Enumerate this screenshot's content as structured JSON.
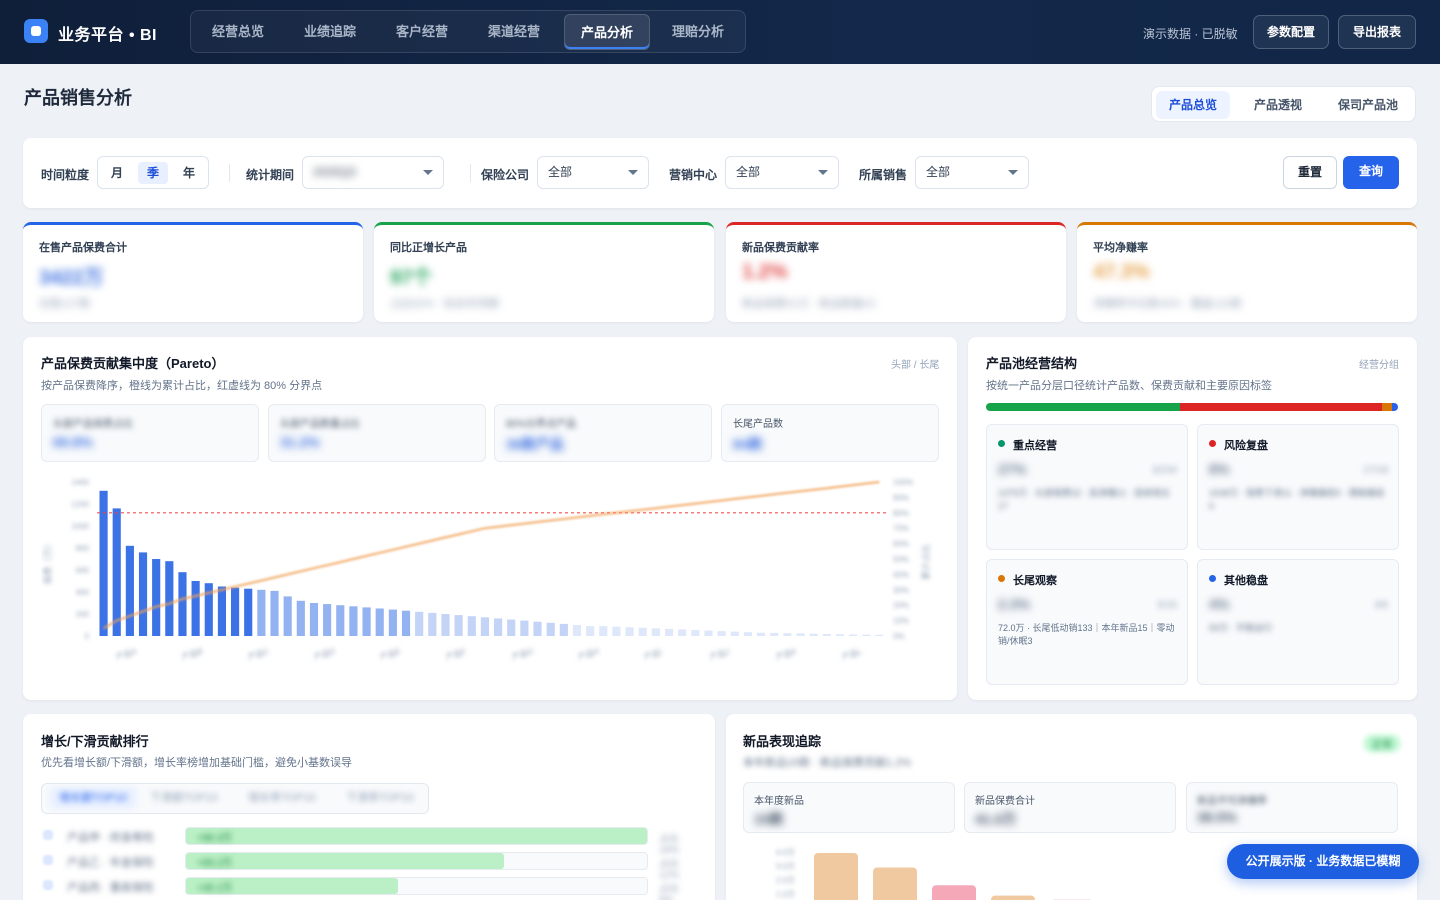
{
  "brand": "业务平台 • BI",
  "nav": {
    "tabs": [
      "经营总览",
      "业绩追踪",
      "客户经营",
      "渠道经营",
      "产品分析",
      "理赔分析"
    ],
    "active": "产品分析"
  },
  "header": {
    "demo_text": "演示数据 · 已脱敏",
    "config_button": "参数配置",
    "export_button": "导出报表"
  },
  "page": {
    "title": "产品销售分析",
    "view_tabs": [
      "产品总览",
      "产品透视",
      "保司产品池"
    ],
    "active_view": "产品总览"
  },
  "filters": {
    "granularity_label": "时间粒度",
    "granularity_options": [
      "月",
      "季",
      "年"
    ],
    "granularity_selected": "季",
    "period_label": "统计期间",
    "period_value": "2025Q3",
    "company_label": "保险公司",
    "company_value": "全部",
    "center_label": "营销中心",
    "center_value": "全部",
    "sales_label": "所属销售",
    "sales_value": "全部",
    "reset_button": "重置",
    "query_button": "查询"
  },
  "kpis": [
    {
      "label": "在售产品保费合计",
      "value": "3422万",
      "sub": "在售127款",
      "color": "#2563eb",
      "value_color": "#3b6fe0"
    },
    {
      "label": "同比正增长产品",
      "value": "97个",
      "sub": "占比62% · 较去年同期",
      "color": "#16a34a",
      "value_color": "#22a35a"
    },
    {
      "label": "新品保费贡献率",
      "value": "1.2%",
      "sub": "新品保费41万 · 新品数量15",
      "color": "#dc2626",
      "value_color": "#e04444"
    },
    {
      "label": "平均净赚率",
      "value": "47.3%",
      "sub": "净赚率中位数43% · 覆盖120款",
      "color": "#d97706",
      "value_color": "#e6a24a"
    }
  ],
  "pareto": {
    "title": "产品保费贡献集中度（Pareto）",
    "subtitle": "按产品保费降序，橙线为累计占比，红虚线为 80% 分界点",
    "tag": "头部 / 长尾",
    "summary": [
      {
        "label": "头部产品保费占比",
        "value": "69.8%"
      },
      {
        "label": "头部产品数量占比",
        "value": "31.2%"
      },
      {
        "label": "80%分界点产品",
        "value": "36款产品"
      },
      {
        "label": "长尾产品数",
        "value": "84款"
      }
    ]
  },
  "chart_data": {
    "type": "bar",
    "title": "产品保费贡献集中度（Pareto）",
    "xlabel": "",
    "ylabel": "保费（万）",
    "y2label": "累计占比",
    "ylim": [
      0,
      1400
    ],
    "y2lim": [
      0,
      100
    ],
    "threshold_percent": 80,
    "series": [
      {
        "type": "bar",
        "values": [
          1320,
          1160,
          820,
          760,
          700,
          680,
          580,
          500,
          480,
          450,
          440,
          430,
          420,
          410,
          360,
          320,
          300,
          290,
          280,
          270,
          260,
          250,
          240,
          230,
          220,
          210,
          200,
          190,
          180,
          170,
          160,
          150,
          140,
          130,
          120,
          110,
          100,
          90,
          90,
          85,
          80,
          75,
          70,
          65,
          60,
          55,
          50,
          45,
          40,
          35,
          30,
          28,
          26,
          24,
          20,
          18,
          16,
          14,
          12,
          10
        ]
      },
      {
        "type": "line",
        "values": [
          5,
          10,
          13,
          16,
          19,
          21,
          24,
          26,
          28,
          30,
          32,
          34,
          36,
          38,
          40,
          42,
          44,
          46,
          48,
          50,
          52,
          54,
          56,
          58,
          60,
          62,
          64,
          66,
          68,
          70,
          71,
          72,
          73,
          74,
          75,
          76,
          77,
          78,
          79,
          80,
          81,
          82,
          83,
          84,
          85,
          86,
          87,
          88,
          89,
          90,
          91,
          92,
          93,
          94,
          95,
          96,
          97,
          98,
          99,
          100
        ]
      }
    ],
    "categories": [
      "产品A",
      "产品B",
      "产品C",
      "产品D",
      "产品E",
      "产品F",
      "产品G",
      "产品H",
      "产品I",
      "产品J",
      "产品K",
      "产品L"
    ],
    "y_ticks": [
      "1400",
      "1200",
      "1000",
      "800",
      "600",
      "400",
      "200",
      "0"
    ],
    "y2_ticks": [
      "100%",
      "90%",
      "80%",
      "70%",
      "60%",
      "50%",
      "40%",
      "30%",
      "20%",
      "10%",
      "0%"
    ]
  },
  "pool": {
    "title": "产品池经营结构",
    "subtitle": "按统一产品分层口径统计产品数、保费贡献和主要原因标签",
    "tag": "经营分组",
    "stack": [
      {
        "share": 47,
        "color": "#16a34a"
      },
      {
        "share": 49,
        "color": "#dc2626"
      },
      {
        "share": 2.5,
        "color": "#d97706"
      },
      {
        "share": 1.5,
        "color": "#2563eb"
      }
    ],
    "groups": [
      {
        "name": "重点经营",
        "value": "27%",
        "count": "32/34",
        "desc": "1375万 · 头部保费32 · 高净赚21 · 连续增长17",
        "color": "#059669"
      },
      {
        "name": "风险复盘",
        "value": "8%",
        "count": "17/18",
        "desc": "1638万 · 保费下滑11 · 净赚偏低9 · 理赔偏高6",
        "color": "#dc2626"
      },
      {
        "name": "长尾观察",
        "value": "2.3%",
        "count": "5/15",
        "desc": "72.0万 · 长尾低动销133｜本年新品15｜零动销/休眠3",
        "color": "#d97706"
      },
      {
        "name": "其他稳盘",
        "value": "4%",
        "count": "3/6",
        "desc": "55万 · 平稳运行",
        "color": "#2563eb"
      }
    ]
  },
  "growth": {
    "title": "增长/下滑贡献排行",
    "subtitle": "优先看增长额/下滑额，增长率榜增加基础门槛，避免小基数误导",
    "tabs": [
      "增长额TOP10",
      "下滑额TOP10",
      "增长率TOP10",
      "下滑率TOP10"
    ],
    "rows": [
      {
        "name": "产品甲 · 终身寿险",
        "value": "+96.3万",
        "share": 100,
        "pct": "占比18%"
      },
      {
        "name": "产品乙 · 年金保险",
        "value": "+65.2万",
        "share": 69,
        "pct": "占比12%"
      },
      {
        "name": "产品丙 · 重疾保险",
        "value": "+45.1万",
        "share": 46,
        "pct": "占比8%"
      }
    ]
  },
  "newprod": {
    "title": "新品表现追踪",
    "badge": "正常",
    "subtitle": "本年新品15款 · 新品保费贡献1.2%",
    "cards": [
      {
        "label": "本年度新品",
        "value": "15款"
      },
      {
        "label": "新品保费合计",
        "value": "41.0万"
      },
      {
        "label": "新品平均净赚率",
        "value": "38.5%"
      }
    ],
    "y_ticks": [
      "4.0万",
      "3.0万",
      "2.0万",
      "1.0万"
    ],
    "bars": [
      {
        "value": 100,
        "color": "#f0c9a0"
      },
      {
        "value": 72,
        "color": "#f0c9a0"
      },
      {
        "value": 38,
        "color": "#f4a8b8"
      },
      {
        "value": 18,
        "color": "#f0c9a0"
      },
      {
        "value": 10,
        "color": "#f4a8b8"
      },
      {
        "value": 6,
        "color": "#f0c9a0"
      }
    ]
  },
  "watermark_badge": "公开展示版 · 业务数据已模糊"
}
